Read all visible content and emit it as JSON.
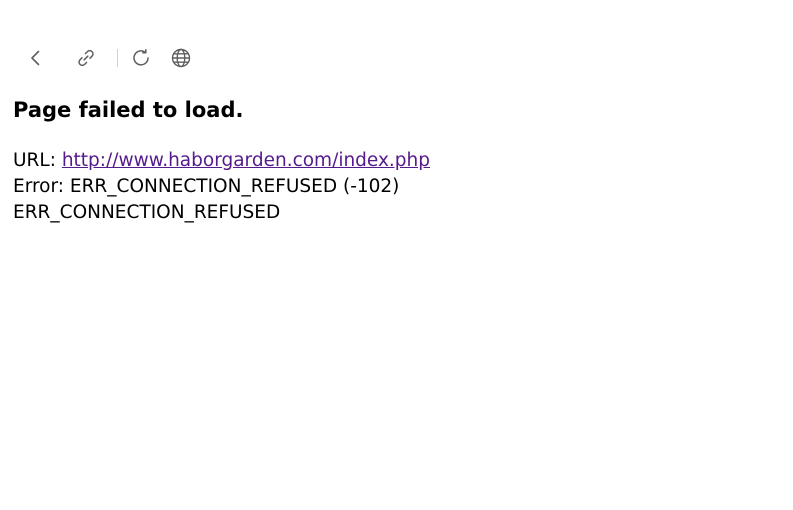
{
  "toolbar": {
    "icons": {
      "back": "chevron-left-icon",
      "link": "link-icon",
      "reload": "reload-icon",
      "globe": "globe-icon"
    },
    "icon_color": "#5f5f5f"
  },
  "error": {
    "title": "Page failed to load.",
    "url_label": "URL: ",
    "url": "http://www.haborgarden.com/index.php",
    "error_line": "Error: ERR_CONNECTION_REFUSED (-102)",
    "error_code": "ERR_CONNECTION_REFUSED"
  },
  "colors": {
    "link_visited": "#551a8b",
    "text": "#000000",
    "background": "#ffffff"
  }
}
